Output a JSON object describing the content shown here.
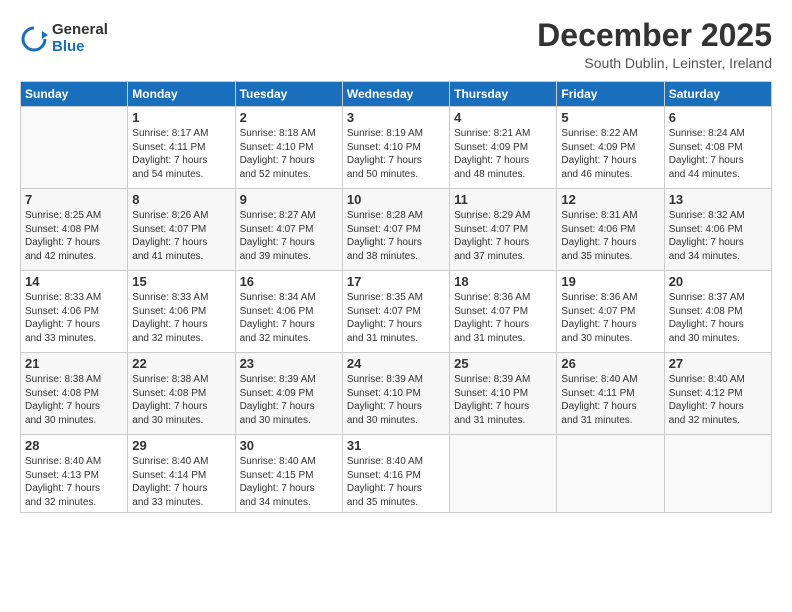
{
  "logo": {
    "general": "General",
    "blue": "Blue"
  },
  "header": {
    "title": "December 2025",
    "location": "South Dublin, Leinster, Ireland"
  },
  "days_of_week": [
    "Sunday",
    "Monday",
    "Tuesday",
    "Wednesday",
    "Thursday",
    "Friday",
    "Saturday"
  ],
  "weeks": [
    [
      {
        "day": "",
        "info": ""
      },
      {
        "day": "1",
        "info": "Sunrise: 8:17 AM\nSunset: 4:11 PM\nDaylight: 7 hours\nand 54 minutes."
      },
      {
        "day": "2",
        "info": "Sunrise: 8:18 AM\nSunset: 4:10 PM\nDaylight: 7 hours\nand 52 minutes."
      },
      {
        "day": "3",
        "info": "Sunrise: 8:19 AM\nSunset: 4:10 PM\nDaylight: 7 hours\nand 50 minutes."
      },
      {
        "day": "4",
        "info": "Sunrise: 8:21 AM\nSunset: 4:09 PM\nDaylight: 7 hours\nand 48 minutes."
      },
      {
        "day": "5",
        "info": "Sunrise: 8:22 AM\nSunset: 4:09 PM\nDaylight: 7 hours\nand 46 minutes."
      },
      {
        "day": "6",
        "info": "Sunrise: 8:24 AM\nSunset: 4:08 PM\nDaylight: 7 hours\nand 44 minutes."
      }
    ],
    [
      {
        "day": "7",
        "info": "Sunrise: 8:25 AM\nSunset: 4:08 PM\nDaylight: 7 hours\nand 42 minutes."
      },
      {
        "day": "8",
        "info": "Sunrise: 8:26 AM\nSunset: 4:07 PM\nDaylight: 7 hours\nand 41 minutes."
      },
      {
        "day": "9",
        "info": "Sunrise: 8:27 AM\nSunset: 4:07 PM\nDaylight: 7 hours\nand 39 minutes."
      },
      {
        "day": "10",
        "info": "Sunrise: 8:28 AM\nSunset: 4:07 PM\nDaylight: 7 hours\nand 38 minutes."
      },
      {
        "day": "11",
        "info": "Sunrise: 8:29 AM\nSunset: 4:07 PM\nDaylight: 7 hours\nand 37 minutes."
      },
      {
        "day": "12",
        "info": "Sunrise: 8:31 AM\nSunset: 4:06 PM\nDaylight: 7 hours\nand 35 minutes."
      },
      {
        "day": "13",
        "info": "Sunrise: 8:32 AM\nSunset: 4:06 PM\nDaylight: 7 hours\nand 34 minutes."
      }
    ],
    [
      {
        "day": "14",
        "info": "Sunrise: 8:33 AM\nSunset: 4:06 PM\nDaylight: 7 hours\nand 33 minutes."
      },
      {
        "day": "15",
        "info": "Sunrise: 8:33 AM\nSunset: 4:06 PM\nDaylight: 7 hours\nand 32 minutes."
      },
      {
        "day": "16",
        "info": "Sunrise: 8:34 AM\nSunset: 4:06 PM\nDaylight: 7 hours\nand 32 minutes."
      },
      {
        "day": "17",
        "info": "Sunrise: 8:35 AM\nSunset: 4:07 PM\nDaylight: 7 hours\nand 31 minutes."
      },
      {
        "day": "18",
        "info": "Sunrise: 8:36 AM\nSunset: 4:07 PM\nDaylight: 7 hours\nand 31 minutes."
      },
      {
        "day": "19",
        "info": "Sunrise: 8:36 AM\nSunset: 4:07 PM\nDaylight: 7 hours\nand 30 minutes."
      },
      {
        "day": "20",
        "info": "Sunrise: 8:37 AM\nSunset: 4:08 PM\nDaylight: 7 hours\nand 30 minutes."
      }
    ],
    [
      {
        "day": "21",
        "info": "Sunrise: 8:38 AM\nSunset: 4:08 PM\nDaylight: 7 hours\nand 30 minutes."
      },
      {
        "day": "22",
        "info": "Sunrise: 8:38 AM\nSunset: 4:08 PM\nDaylight: 7 hours\nand 30 minutes."
      },
      {
        "day": "23",
        "info": "Sunrise: 8:39 AM\nSunset: 4:09 PM\nDaylight: 7 hours\nand 30 minutes."
      },
      {
        "day": "24",
        "info": "Sunrise: 8:39 AM\nSunset: 4:10 PM\nDaylight: 7 hours\nand 30 minutes."
      },
      {
        "day": "25",
        "info": "Sunrise: 8:39 AM\nSunset: 4:10 PM\nDaylight: 7 hours\nand 31 minutes."
      },
      {
        "day": "26",
        "info": "Sunrise: 8:40 AM\nSunset: 4:11 PM\nDaylight: 7 hours\nand 31 minutes."
      },
      {
        "day": "27",
        "info": "Sunrise: 8:40 AM\nSunset: 4:12 PM\nDaylight: 7 hours\nand 32 minutes."
      }
    ],
    [
      {
        "day": "28",
        "info": "Sunrise: 8:40 AM\nSunset: 4:13 PM\nDaylight: 7 hours\nand 32 minutes."
      },
      {
        "day": "29",
        "info": "Sunrise: 8:40 AM\nSunset: 4:14 PM\nDaylight: 7 hours\nand 33 minutes."
      },
      {
        "day": "30",
        "info": "Sunrise: 8:40 AM\nSunset: 4:15 PM\nDaylight: 7 hours\nand 34 minutes."
      },
      {
        "day": "31",
        "info": "Sunrise: 8:40 AM\nSunset: 4:16 PM\nDaylight: 7 hours\nand 35 minutes."
      },
      {
        "day": "",
        "info": ""
      },
      {
        "day": "",
        "info": ""
      },
      {
        "day": "",
        "info": ""
      }
    ]
  ]
}
